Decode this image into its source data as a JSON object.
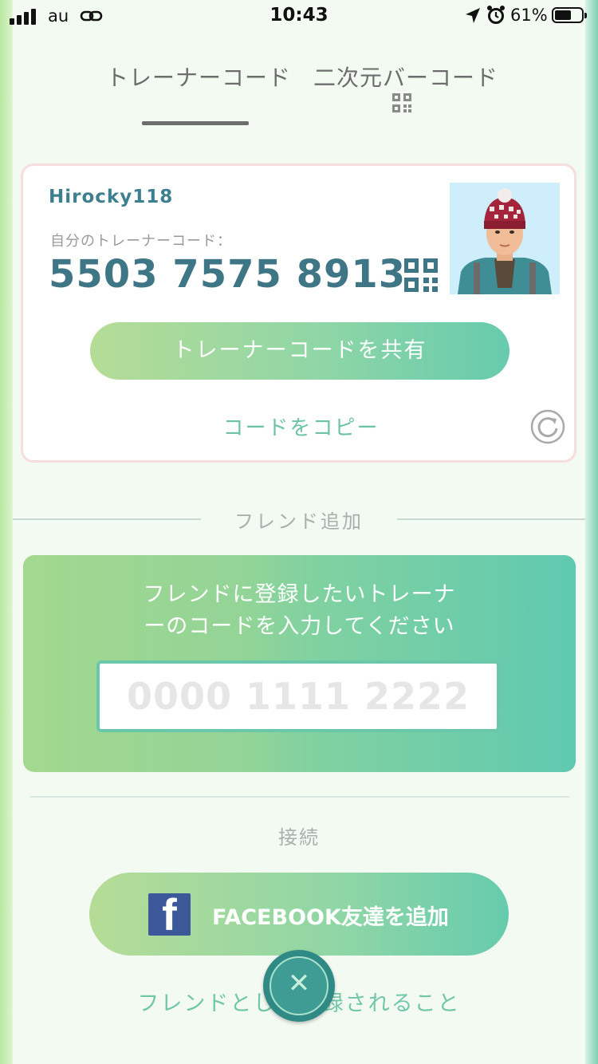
{
  "status_bar": {
    "carrier": "au",
    "time": "10:43",
    "battery_percent": "61%",
    "battery_level": 0.61,
    "icons": [
      "signal-icon",
      "link-icon",
      "location-arrow-icon",
      "alarm-icon",
      "battery-icon"
    ]
  },
  "tabs": {
    "trainer_code": "トレーナーコード",
    "qr_code": "二次元バーコード",
    "active": "trainer_code"
  },
  "profile": {
    "username": "Hirocky118",
    "code_label": "自分のトレーナーコード：",
    "code_value": "5503 7575 8913",
    "share_button": "トレーナーコードを共有",
    "copy_link": "コードをコピー"
  },
  "friend_add": {
    "title": "フレンド追加",
    "instructions_line1": "フレンドに登録したいトレーナ",
    "instructions_line2": "ーのコードを入力してください",
    "input_placeholder": "0000 1111 2222",
    "input_value": ""
  },
  "connect": {
    "title": "接続",
    "facebook_button": "FACEBOOK友達を追加",
    "facebook_icon_letter": "f",
    "bottom_link": "フレンドとして登録されること"
  },
  "colors": {
    "accent_green": "#6cc2a7",
    "username_teal": "#3e7f8f",
    "facebook_blue": "#3b5998",
    "close_button": "#2f8a86"
  }
}
